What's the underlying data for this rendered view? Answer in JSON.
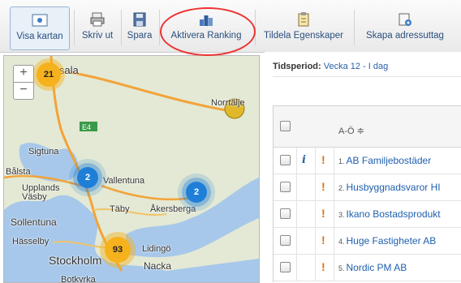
{
  "toolbar": {
    "buttons": [
      {
        "label": "Visa kartan",
        "icon": "map-icon"
      },
      {
        "label": "Skriv ut",
        "icon": "printer-icon"
      },
      {
        "label": "Spara",
        "icon": "save-icon"
      },
      {
        "label": "Aktivera Ranking",
        "icon": "ranking-icon"
      },
      {
        "label": "Tildela Egenskaper",
        "icon": "clipboard-icon"
      },
      {
        "label": "Skapa adressuttag",
        "icon": "address-export-icon"
      }
    ]
  },
  "map": {
    "zoom_in": "+",
    "zoom_out": "−",
    "clusters": [
      "21",
      "2",
      "2",
      "93"
    ],
    "places": [
      "Uppsala",
      "Norrtälje",
      "E4",
      "Sigtuna",
      "Bålsta",
      "Upplands Väsby",
      "Vallentuna",
      "Täby",
      "Åkersberga",
      "Sollentuna",
      "Hässelby",
      "Lidingö",
      "Stockholm",
      "Nacka",
      "Botkyrka"
    ]
  },
  "panel": {
    "period_label": "Tidsperiod:",
    "period_value": "Vecka 12 - I dag",
    "column_sort": "A-Ö ≑",
    "rows": [
      {
        "num": "1.",
        "name": "AB Familjebostäder",
        "info": true
      },
      {
        "num": "2.",
        "name": "Husbyggnadsvaror HI",
        "info": false
      },
      {
        "num": "3.",
        "name": "Ikano Bostadsprodukt",
        "info": false
      },
      {
        "num": "4.",
        "name": "Huge Fastigheter AB",
        "info": false
      },
      {
        "num": "5.",
        "name": "Nordic PM AB",
        "info": false
      }
    ]
  },
  "colors": {
    "accent": "#2a4f7e",
    "link": "#1f5fae",
    "cluster_orange": "#f5b21c",
    "cluster_blue": "#1f7fd8",
    "warning": "#e07010",
    "highlight_ring": "#ee3333"
  }
}
